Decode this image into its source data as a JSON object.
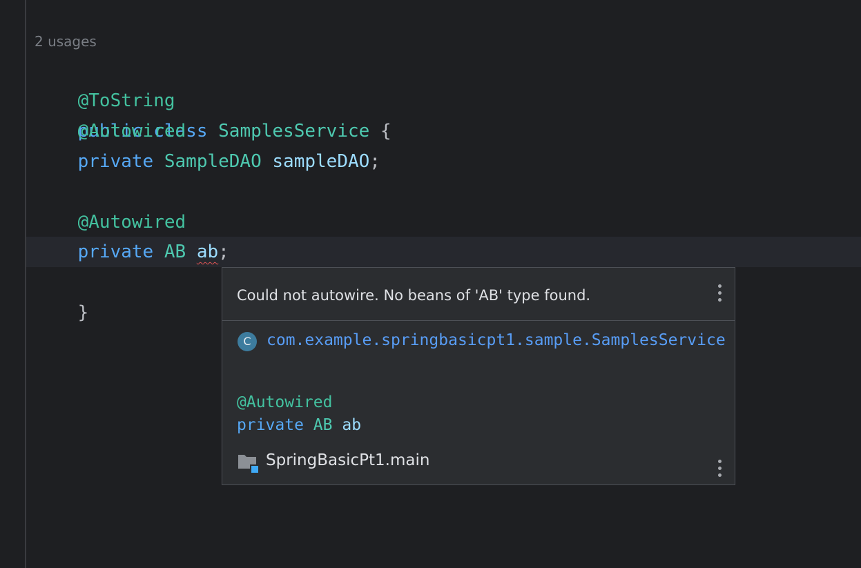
{
  "editor": {
    "usages_hint": "2 usages",
    "lines": {
      "l1": {
        "annotation": "@ToString"
      },
      "l2": {
        "kw_public": "public",
        "kw_class": "class",
        "class_name": "SamplesService",
        "brace": "{"
      },
      "l3": {
        "annotation": "@Autowired"
      },
      "l4": {
        "kw_private": "private",
        "type": "SampleDAO",
        "field": "sampleDAO",
        "semi": ";"
      },
      "l6": {
        "annotation": "@Autowired"
      },
      "l7": {
        "kw_private": "private",
        "type": "AB",
        "field": "ab",
        "semi": ";"
      },
      "l8": {
        "brace": "}"
      }
    }
  },
  "popup": {
    "message": "Could not autowire. No beans of 'AB' type found.",
    "class_icon_letter": "C",
    "class_path": "com.example.springbasicpt1.sample.SamplesService",
    "signature": {
      "annotation": "@Autowired",
      "kw_private": "private",
      "type": "AB",
      "field": "ab"
    },
    "module": "SpringBasicPt1.main"
  },
  "colors": {
    "background": "#1e1f22",
    "keyword": "#56a8f5",
    "annotation": "#43c19f",
    "type": "#4ec9b0",
    "error_underline": "#e25555",
    "popup_background": "#2b2d30",
    "link": "#589df6"
  },
  "icons": {
    "popup_menu": "more-vertical-icon",
    "class": "class-c-icon",
    "module": "folder-module-icon"
  }
}
